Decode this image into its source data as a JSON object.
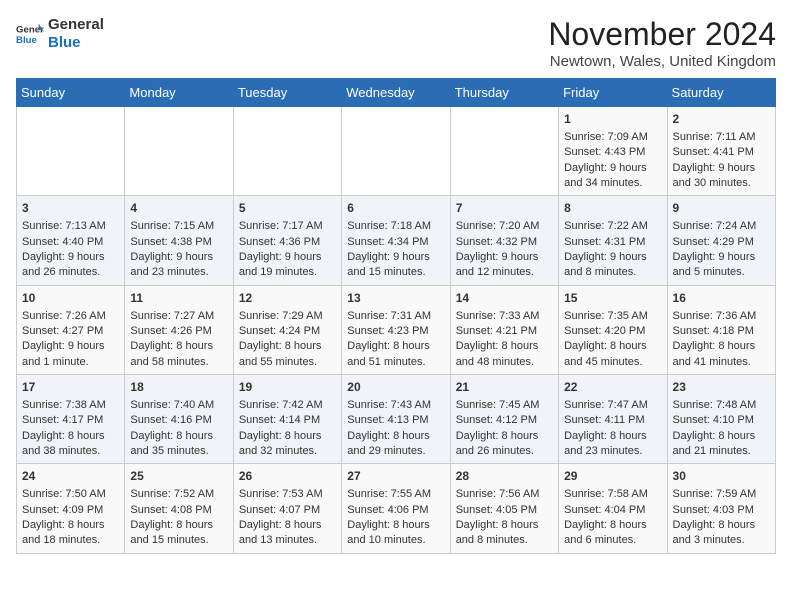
{
  "header": {
    "logo_general": "General",
    "logo_blue": "Blue",
    "month_title": "November 2024",
    "subtitle": "Newtown, Wales, United Kingdom"
  },
  "days_of_week": [
    "Sunday",
    "Monday",
    "Tuesday",
    "Wednesday",
    "Thursday",
    "Friday",
    "Saturday"
  ],
  "weeks": [
    [
      {
        "day": "",
        "content": ""
      },
      {
        "day": "",
        "content": ""
      },
      {
        "day": "",
        "content": ""
      },
      {
        "day": "",
        "content": ""
      },
      {
        "day": "",
        "content": ""
      },
      {
        "day": "1",
        "content": "Sunrise: 7:09 AM\nSunset: 4:43 PM\nDaylight: 9 hours and 34 minutes."
      },
      {
        "day": "2",
        "content": "Sunrise: 7:11 AM\nSunset: 4:41 PM\nDaylight: 9 hours and 30 minutes."
      }
    ],
    [
      {
        "day": "3",
        "content": "Sunrise: 7:13 AM\nSunset: 4:40 PM\nDaylight: 9 hours and 26 minutes."
      },
      {
        "day": "4",
        "content": "Sunrise: 7:15 AM\nSunset: 4:38 PM\nDaylight: 9 hours and 23 minutes."
      },
      {
        "day": "5",
        "content": "Sunrise: 7:17 AM\nSunset: 4:36 PM\nDaylight: 9 hours and 19 minutes."
      },
      {
        "day": "6",
        "content": "Sunrise: 7:18 AM\nSunset: 4:34 PM\nDaylight: 9 hours and 15 minutes."
      },
      {
        "day": "7",
        "content": "Sunrise: 7:20 AM\nSunset: 4:32 PM\nDaylight: 9 hours and 12 minutes."
      },
      {
        "day": "8",
        "content": "Sunrise: 7:22 AM\nSunset: 4:31 PM\nDaylight: 9 hours and 8 minutes."
      },
      {
        "day": "9",
        "content": "Sunrise: 7:24 AM\nSunset: 4:29 PM\nDaylight: 9 hours and 5 minutes."
      }
    ],
    [
      {
        "day": "10",
        "content": "Sunrise: 7:26 AM\nSunset: 4:27 PM\nDaylight: 9 hours and 1 minute."
      },
      {
        "day": "11",
        "content": "Sunrise: 7:27 AM\nSunset: 4:26 PM\nDaylight: 8 hours and 58 minutes."
      },
      {
        "day": "12",
        "content": "Sunrise: 7:29 AM\nSunset: 4:24 PM\nDaylight: 8 hours and 55 minutes."
      },
      {
        "day": "13",
        "content": "Sunrise: 7:31 AM\nSunset: 4:23 PM\nDaylight: 8 hours and 51 minutes."
      },
      {
        "day": "14",
        "content": "Sunrise: 7:33 AM\nSunset: 4:21 PM\nDaylight: 8 hours and 48 minutes."
      },
      {
        "day": "15",
        "content": "Sunrise: 7:35 AM\nSunset: 4:20 PM\nDaylight: 8 hours and 45 minutes."
      },
      {
        "day": "16",
        "content": "Sunrise: 7:36 AM\nSunset: 4:18 PM\nDaylight: 8 hours and 41 minutes."
      }
    ],
    [
      {
        "day": "17",
        "content": "Sunrise: 7:38 AM\nSunset: 4:17 PM\nDaylight: 8 hours and 38 minutes."
      },
      {
        "day": "18",
        "content": "Sunrise: 7:40 AM\nSunset: 4:16 PM\nDaylight: 8 hours and 35 minutes."
      },
      {
        "day": "19",
        "content": "Sunrise: 7:42 AM\nSunset: 4:14 PM\nDaylight: 8 hours and 32 minutes."
      },
      {
        "day": "20",
        "content": "Sunrise: 7:43 AM\nSunset: 4:13 PM\nDaylight: 8 hours and 29 minutes."
      },
      {
        "day": "21",
        "content": "Sunrise: 7:45 AM\nSunset: 4:12 PM\nDaylight: 8 hours and 26 minutes."
      },
      {
        "day": "22",
        "content": "Sunrise: 7:47 AM\nSunset: 4:11 PM\nDaylight: 8 hours and 23 minutes."
      },
      {
        "day": "23",
        "content": "Sunrise: 7:48 AM\nSunset: 4:10 PM\nDaylight: 8 hours and 21 minutes."
      }
    ],
    [
      {
        "day": "24",
        "content": "Sunrise: 7:50 AM\nSunset: 4:09 PM\nDaylight: 8 hours and 18 minutes."
      },
      {
        "day": "25",
        "content": "Sunrise: 7:52 AM\nSunset: 4:08 PM\nDaylight: 8 hours and 15 minutes."
      },
      {
        "day": "26",
        "content": "Sunrise: 7:53 AM\nSunset: 4:07 PM\nDaylight: 8 hours and 13 minutes."
      },
      {
        "day": "27",
        "content": "Sunrise: 7:55 AM\nSunset: 4:06 PM\nDaylight: 8 hours and 10 minutes."
      },
      {
        "day": "28",
        "content": "Sunrise: 7:56 AM\nSunset: 4:05 PM\nDaylight: 8 hours and 8 minutes."
      },
      {
        "day": "29",
        "content": "Sunrise: 7:58 AM\nSunset: 4:04 PM\nDaylight: 8 hours and 6 minutes."
      },
      {
        "day": "30",
        "content": "Sunrise: 7:59 AM\nSunset: 4:03 PM\nDaylight: 8 hours and 3 minutes."
      }
    ]
  ]
}
